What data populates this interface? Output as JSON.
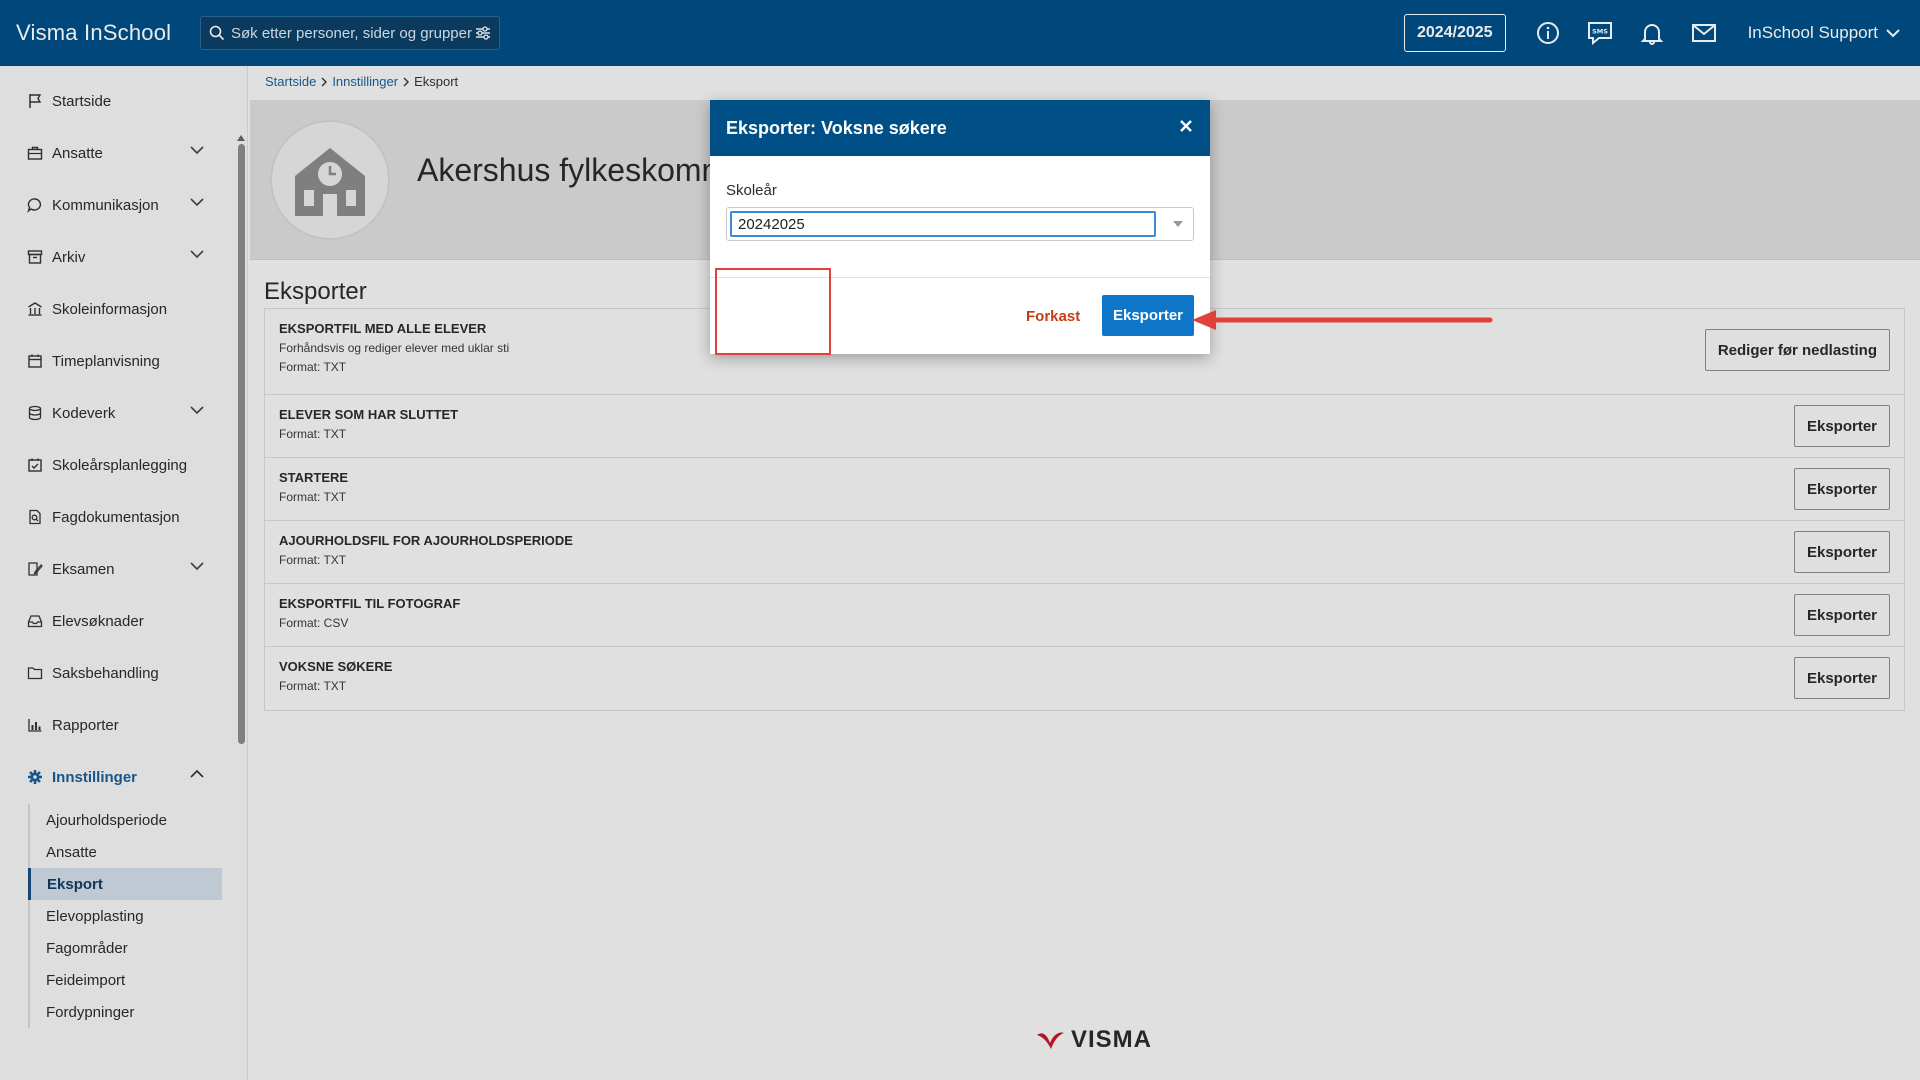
{
  "topbar": {
    "brand": "Visma InSchool",
    "search_placeholder": "Søk etter personer, sider og grupper",
    "school_year": "2024/2025",
    "user": "InSchool Support",
    "icons": [
      "info-icon",
      "sms-icon",
      "bell-icon",
      "mail-icon"
    ]
  },
  "sidebar": {
    "items": [
      {
        "label": "Startside",
        "icon": "flag-icon",
        "expandable": false
      },
      {
        "label": "Ansatte",
        "icon": "briefcase-icon",
        "expandable": true
      },
      {
        "label": "Kommunikasjon",
        "icon": "chat-icon",
        "expandable": true
      },
      {
        "label": "Arkiv",
        "icon": "archive-icon",
        "expandable": true
      },
      {
        "label": "Skoleinformasjon",
        "icon": "building-icon",
        "expandable": false
      },
      {
        "label": "Timeplanvisning",
        "icon": "calendar-icon",
        "expandable": false
      },
      {
        "label": "Kodeverk",
        "icon": "database-icon",
        "expandable": true
      },
      {
        "label": "Skoleårsplanlegging",
        "icon": "calendar-check-icon",
        "expandable": false
      },
      {
        "label": "Fagdokumentasjon",
        "icon": "document-search-icon",
        "expandable": false
      },
      {
        "label": "Eksamen",
        "icon": "exam-icon",
        "expandable": true
      },
      {
        "label": "Elevsøknader",
        "icon": "inbox-icon",
        "expandable": false
      },
      {
        "label": "Saksbehandling",
        "icon": "folder-icon",
        "expandable": false
      },
      {
        "label": "Rapporter",
        "icon": "bar-chart-icon",
        "expandable": false
      },
      {
        "label": "Innstillinger",
        "icon": "gear-icon",
        "expandable": true
      }
    ],
    "subitems": [
      {
        "label": "Ajourholdsperiode"
      },
      {
        "label": "Ansatte"
      },
      {
        "label": "Eksport"
      },
      {
        "label": "Elevopplasting"
      },
      {
        "label": "Fagområder"
      },
      {
        "label": "Feideimport"
      },
      {
        "label": "Fordypninger"
      }
    ]
  },
  "breadcrumb": {
    "items": [
      "Startside",
      "Innstillinger"
    ],
    "current": "Eksport"
  },
  "header": {
    "org_name": "Akershus fylkeskommune"
  },
  "main": {
    "section_title": "Eksporter",
    "rows": [
      {
        "title": "EKSPORTFIL MED ALLE ELEVER",
        "description": "Forhåndsvis og rediger elever med uklar sti",
        "format": "Format: TXT",
        "button": "Rediger før nedlasting"
      },
      {
        "title": "ELEVER SOM HAR SLUTTET",
        "format": "Format: TXT",
        "button": "Eksporter"
      },
      {
        "title": "STARTERE",
        "format": "Format: TXT",
        "button": "Eksporter"
      },
      {
        "title": "AJOURHOLDSFIL FOR AJOURHOLDSPERIODE",
        "format": "Format: TXT",
        "button": "Eksporter"
      },
      {
        "title": "EKSPORTFIL TIL FOTOGRAF",
        "format": "Format: CSV",
        "button": "Eksporter"
      },
      {
        "title": "VOKSNE SØKERE",
        "format": "Format: TXT",
        "button": "Eksporter"
      }
    ]
  },
  "modal": {
    "title": "Eksporter: Voksne søkere",
    "field_label": "Skoleår",
    "field_value": "20242025",
    "cancel": "Forkast",
    "confirm": "Eksporter"
  },
  "footer": {
    "logo_text": "VISMA"
  },
  "colors": {
    "topbar": "#004f87",
    "accent": "#0d76c8",
    "cancel": "#c63b14",
    "annotation": "#e0423a"
  }
}
